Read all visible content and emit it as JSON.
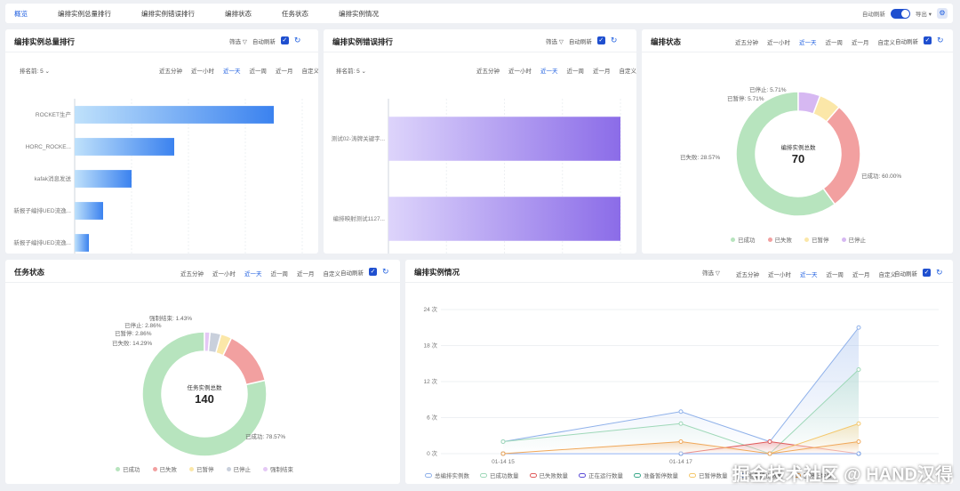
{
  "tabs": [
    "概览",
    "编排实例总量排行",
    "编排实例错误排行",
    "编排状态",
    "任务状态",
    "编排实例情况"
  ],
  "header_right": {
    "auto_refresh": "自动刷新",
    "export": "导出",
    "export_caret": "▾",
    "gear_icon": "⚙"
  },
  "common": {
    "filter": "筛选",
    "filter_icon": "▽",
    "auto_refresh": "自动刷新",
    "check": "✓",
    "refresh_icon": "↻",
    "rank_label": "排名前: 5",
    "caret": "⌄"
  },
  "time_ranges": [
    "近五分钟",
    "近一小时",
    "近一天",
    "近一周",
    "近一月",
    "自定义"
  ],
  "active_time_range": "近一天",
  "panel_titles": {
    "total": "编排实例总量排行",
    "error": "编排实例错误排行",
    "status": "编排状态",
    "task": "任务状态",
    "situation": "编排实例情况"
  },
  "watermark": "掘金技术社区 @ HAND汉得",
  "colors": {
    "accent": "#1f5fe0",
    "success": "#b7e4be",
    "fail": "#f2a0a0",
    "paused": "#fbe7a8",
    "stopped": "#d6b8f2"
  },
  "chart_data": [
    {
      "type": "bar",
      "orientation": "horizontal",
      "title": "编排实例总量排行",
      "categories": [
        "ROCKET生产",
        "HORC_ROCKE...",
        "kafak消息发送",
        "新报子编排UED流逸...",
        "新报子编排UED流逸..."
      ],
      "values": [
        14,
        7,
        4,
        2,
        1
      ],
      "xlim": [
        0,
        16
      ],
      "xticks": [
        "0",
        "4",
        "8",
        "12",
        "16"
      ]
    },
    {
      "type": "bar",
      "orientation": "horizontal",
      "title": "编排实例错误排行",
      "categories": [
        "测试02-涛牌关键字...",
        "编排映射测试1127..."
      ],
      "values": [
        1,
        1
      ],
      "xlim": [
        0,
        1
      ],
      "xticks": [
        "0",
        "0.25",
        "0.5",
        "0.75",
        "1"
      ]
    },
    {
      "type": "pie",
      "title": "编排状态",
      "center_label": "编排实例总数",
      "center_value": "70",
      "slices": [
        {
          "name": "已成功",
          "value": 60.0,
          "label": "已成功: 60.00%",
          "color": "#b7e4be"
        },
        {
          "name": "已失败",
          "value": 28.57,
          "label": "已失败: 28.57%",
          "color": "#f2a0a0"
        },
        {
          "name": "已暂停",
          "value": 5.71,
          "label": "已暂停: 5.71%",
          "color": "#fbe7a8"
        },
        {
          "name": "已停止",
          "value": 5.71,
          "label": "已停止: 5.71%",
          "color": "#d6b8f2"
        }
      ]
    },
    {
      "type": "pie",
      "title": "任务状态",
      "center_label": "任务实例总数",
      "center_value": "140",
      "slices": [
        {
          "name": "已成功",
          "value": 78.57,
          "label": "已成功: 78.57%",
          "color": "#b7e4be"
        },
        {
          "name": "已失败",
          "value": 14.29,
          "label": "已失败: 14.29%",
          "color": "#f2a0a0"
        },
        {
          "name": "已暂停",
          "value": 2.86,
          "label": "已暂停: 2.86%",
          "color": "#fbe7a8"
        },
        {
          "name": "已停止",
          "value": 2.86,
          "label": "已停止: 2.86%",
          "color": "#c9d0dc"
        },
        {
          "name": "强制结束",
          "value": 1.43,
          "label": "强制结束: 1.43%",
          "color": "#e4c8f5"
        }
      ]
    },
    {
      "type": "line",
      "title": "编排实例情况",
      "x": [
        "01-14 15",
        "01-14 16",
        "01-14 17",
        "01-14 18",
        "01-14 19"
      ],
      "xtick_labels": [
        "01-14 15",
        "",
        "01-14 17",
        "",
        ""
      ],
      "yticks": [
        "0 次",
        "6 次",
        "12 次",
        "18 次",
        "24 次"
      ],
      "ylim": [
        0,
        24
      ],
      "series": [
        {
          "name": "总编排实例数",
          "values": [
            2,
            null,
            7,
            2,
            21
          ],
          "color": "#8fb1ea"
        },
        {
          "name": "已成功数量",
          "values": [
            2,
            null,
            5,
            0,
            14
          ],
          "color": "#9ed8b8"
        },
        {
          "name": "已失败数量",
          "values": [
            0,
            null,
            0,
            2,
            0
          ],
          "color": "#e05a5a"
        },
        {
          "name": "正在运行数量",
          "values": [
            0,
            null,
            0,
            0,
            0
          ],
          "color": "#5b4bd6"
        },
        {
          "name": "准备暂停数量",
          "values": [
            0,
            null,
            0,
            0,
            0
          ],
          "color": "#3aa88a"
        },
        {
          "name": "已暂停数量",
          "values": [
            0,
            null,
            0,
            0,
            5
          ],
          "color": "#f4c76a"
        },
        {
          "name": "准备终止数量",
          "values": [
            0,
            null,
            0,
            0,
            0
          ],
          "color": "#7aa2f0"
        },
        {
          "name": "已停止数量",
          "values": [
            0,
            null,
            2,
            0,
            2
          ],
          "color": "#f0a85a"
        }
      ]
    }
  ]
}
